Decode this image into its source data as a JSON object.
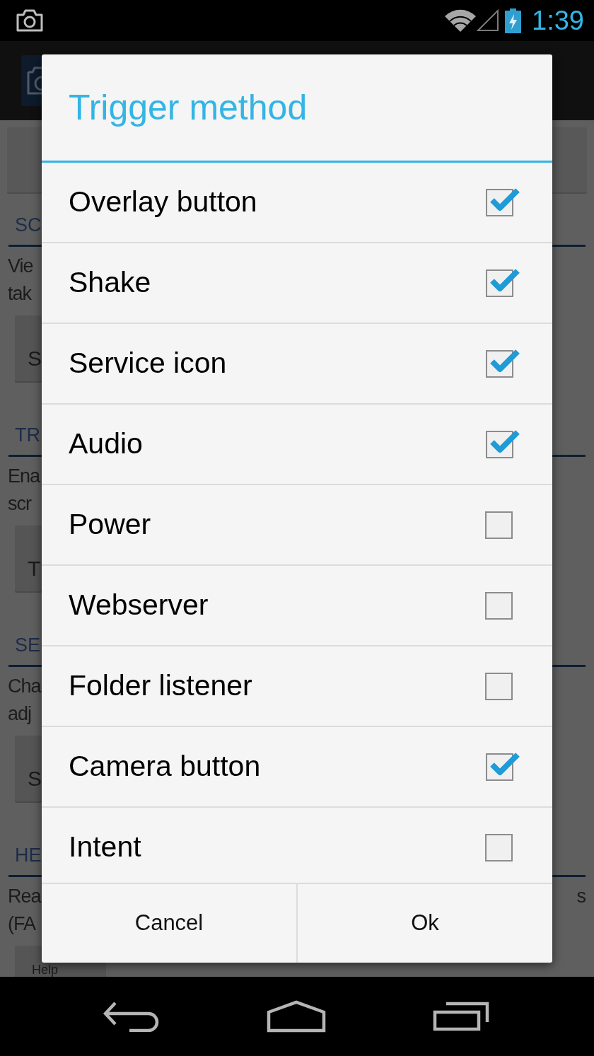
{
  "status_bar": {
    "time": "1:39"
  },
  "app": {
    "sections": [
      {
        "header": "SC",
        "lines": [
          {
            "start": "Vie"
          },
          {
            "start": "tak"
          }
        ],
        "button": "S"
      },
      {
        "header": "TR",
        "lines": [
          {
            "start": "Ena"
          },
          {
            "start": "scr"
          }
        ],
        "button": "T"
      },
      {
        "header": "SE",
        "lines": [
          {
            "start": "Cha"
          },
          {
            "start": "adj"
          }
        ],
        "button": "S"
      },
      {
        "header": "HE",
        "lines": [
          {
            "start": "Rea",
            "end": "s"
          },
          {
            "start": "(FA"
          }
        ],
        "button": "Help"
      }
    ]
  },
  "dialog": {
    "title": "Trigger method",
    "options": [
      {
        "label": "Overlay button",
        "checked": true
      },
      {
        "label": "Shake",
        "checked": true
      },
      {
        "label": "Service icon",
        "checked": true
      },
      {
        "label": "Audio",
        "checked": true
      },
      {
        "label": "Power",
        "checked": false
      },
      {
        "label": "Webserver",
        "checked": false
      },
      {
        "label": "Folder listener",
        "checked": false
      },
      {
        "label": "Camera button",
        "checked": true
      },
      {
        "label": "Intent",
        "checked": false
      }
    ],
    "buttons": [
      "Cancel",
      "Ok"
    ]
  }
}
